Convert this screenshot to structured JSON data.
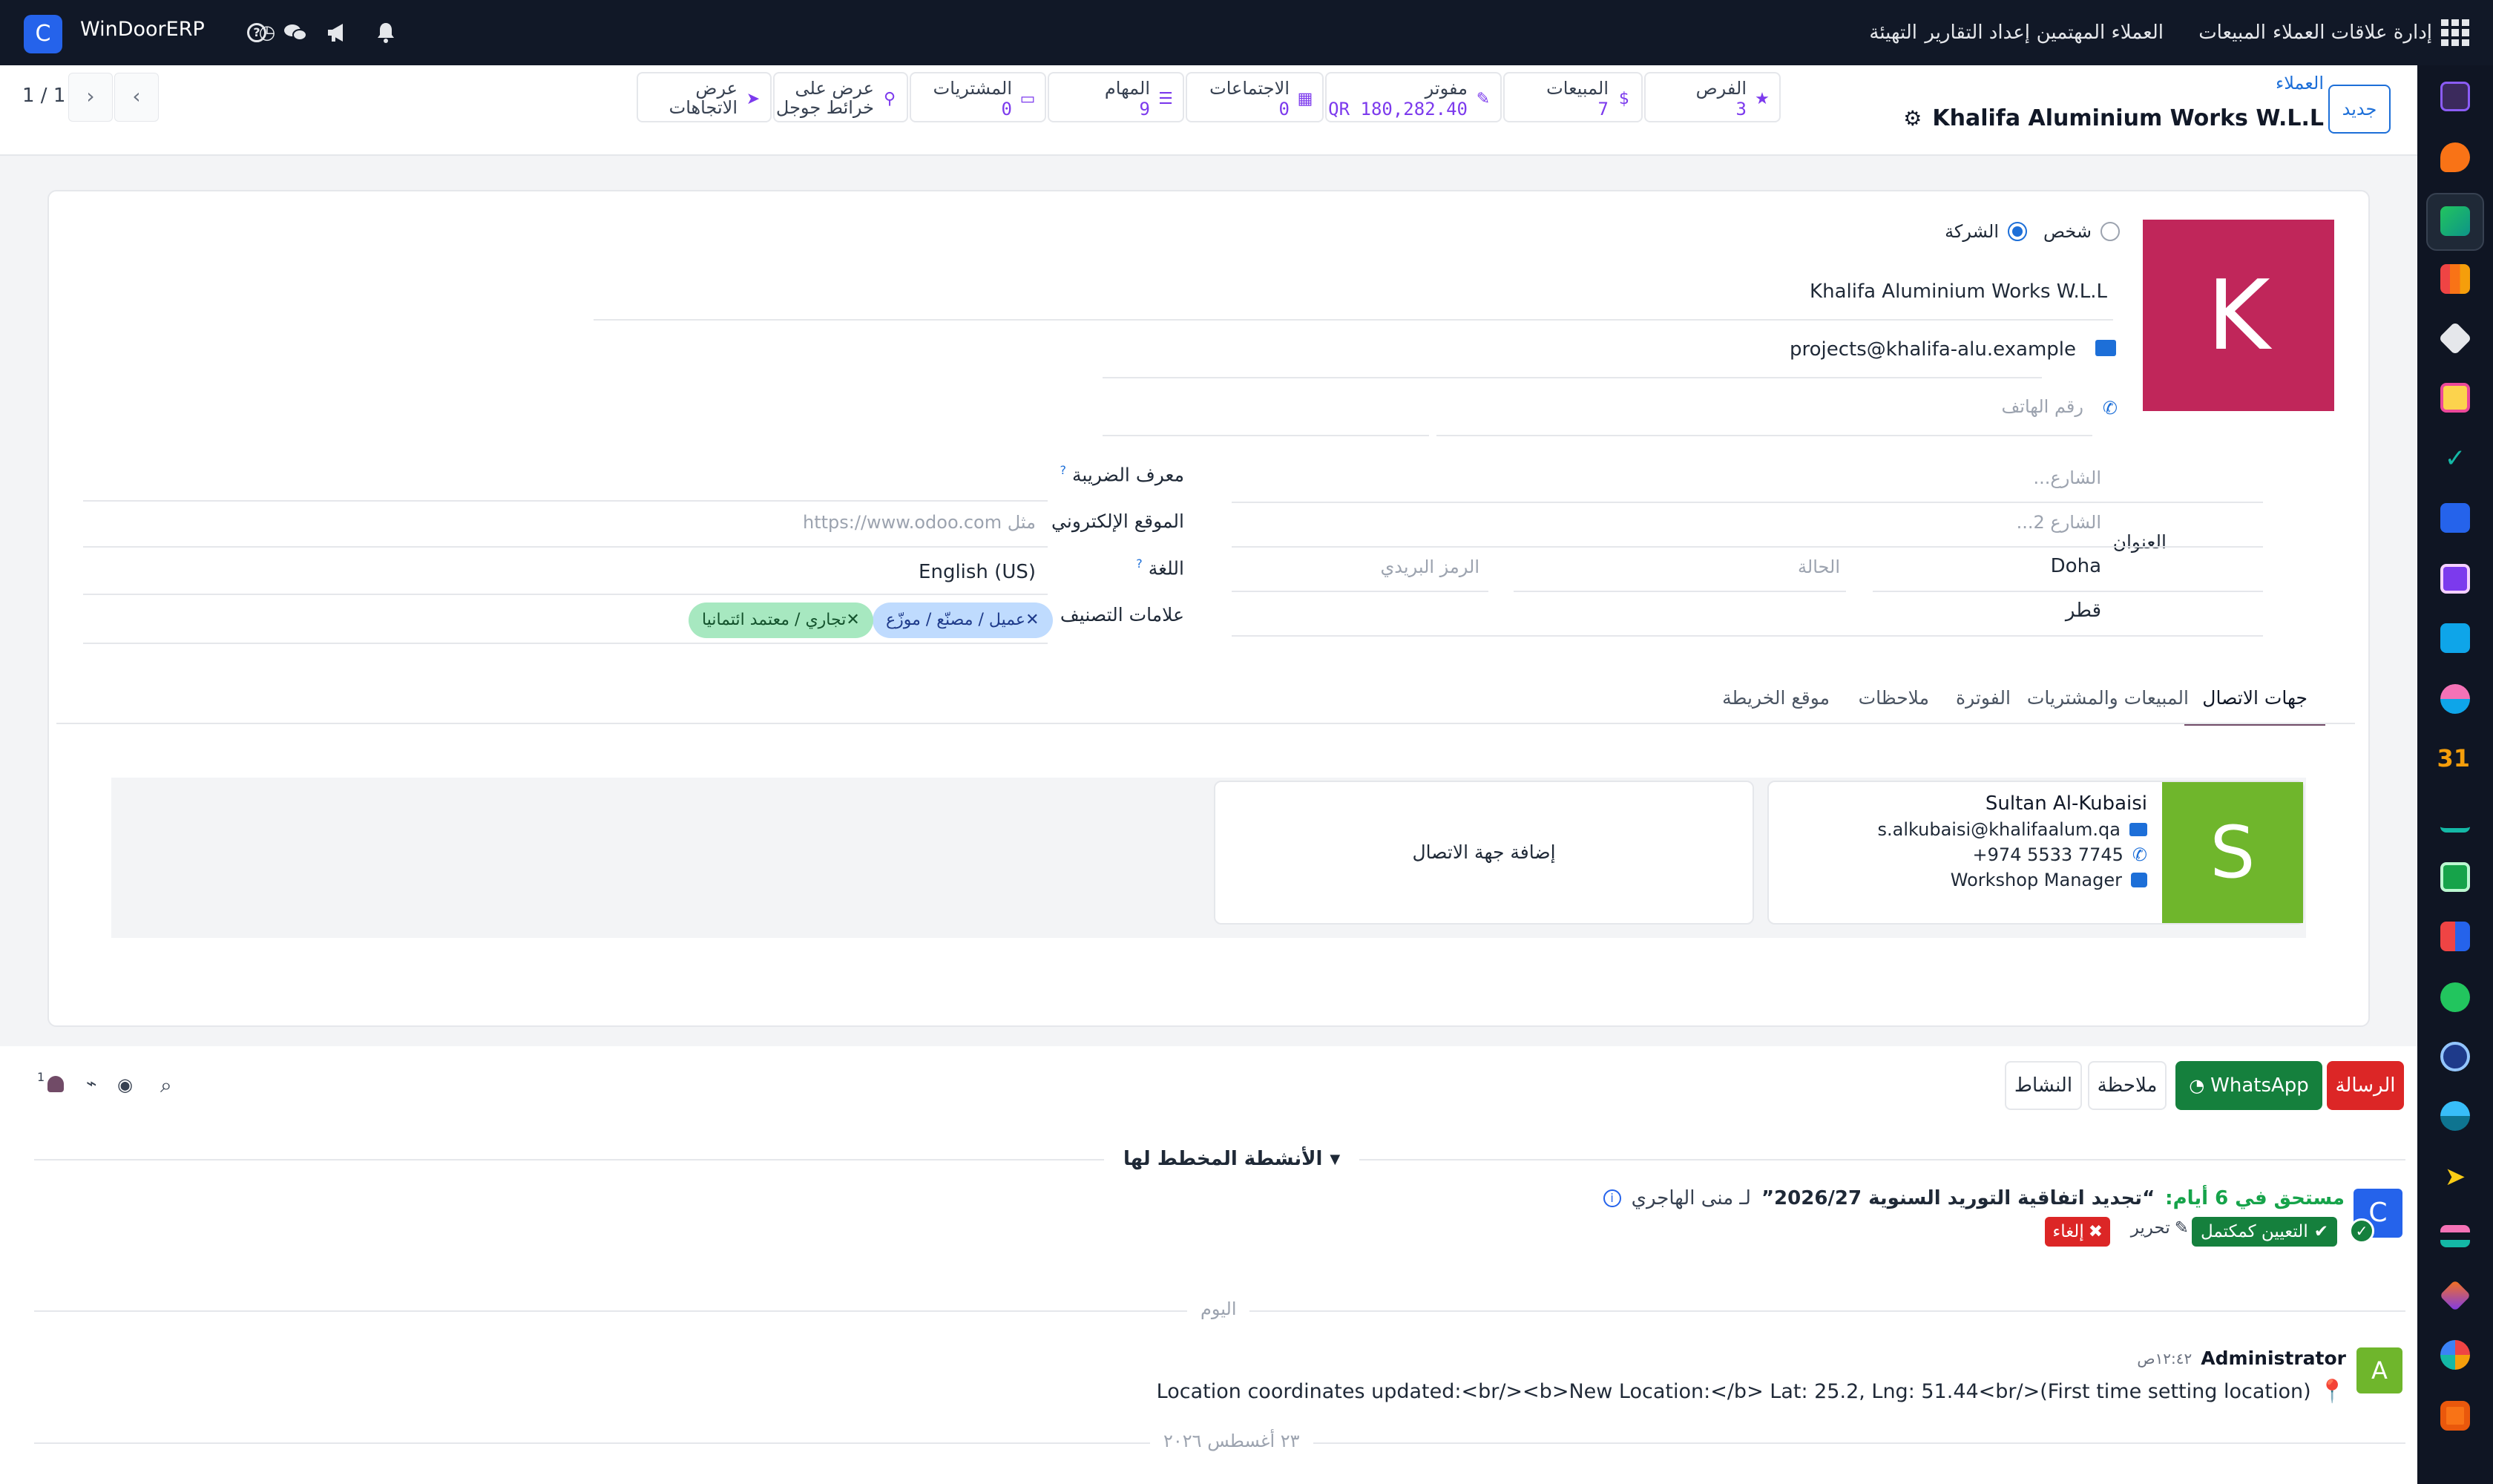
{
  "topbar": {
    "brand": "WinDoorERP",
    "menu": [
      "إدارة علاقات العملاء",
      "المبيعات",
      "العملاء المهتمين",
      "إعداد التقارير",
      "التهيئة"
    ]
  },
  "breadcrumb": {
    "parent": "العملاء",
    "current": "Khalifa Aluminium Works W.L.L"
  },
  "control": {
    "new_label": "جديد",
    "pager": "1 / 1"
  },
  "smart_buttons": [
    {
      "label": "الفرص",
      "value": "3",
      "icon": "star-icon"
    },
    {
      "label": "المبيعات",
      "value": "7",
      "icon": "dollar-icon"
    },
    {
      "label": "مفوتر",
      "value": "180,282.40 QR",
      "icon": "invoice-edit-icon"
    },
    {
      "label": "الاجتماعات",
      "value": "0",
      "icon": "calendar-icon"
    },
    {
      "label": "المهام",
      "value": "9",
      "icon": "tasks-icon"
    },
    {
      "label": "المشتريات",
      "value": "0",
      "icon": "credit-card-icon"
    },
    {
      "label": "عرض على",
      "label2": "خرائط جوجل",
      "icon": "map-marker-icon"
    },
    {
      "label": "عرض",
      "label2": "الاتجاهات",
      "icon": "direction-icon"
    }
  ],
  "form": {
    "avatar_letter": "K",
    "type_person": "شخص",
    "type_company": "الشركة",
    "name": "Khalifa Aluminium Works W.L.L",
    "email": "projects@khalifa-alu.example",
    "phone_placeholder": "رقم الهاتف",
    "address_label": "العنوان",
    "street_placeholder": "الشارع...",
    "street2_placeholder": "الشارع 2...",
    "city": "Doha",
    "state_placeholder": "الحالة",
    "zip_placeholder": "الرمز البريدي",
    "country": "قطر",
    "vat_label": "معرف الضريبة",
    "website_label": "الموقع الإلكتروني",
    "website_placeholder": "مثل https://www.odoo.com",
    "lang_label": "اللغة",
    "lang_value": "English (US)",
    "tags_label": "علامات التصنيف",
    "tags": [
      "عميل / مصنّع / موزّع",
      "تجاري / معتمد ائتمانيا"
    ],
    "tabs": [
      "جهات الاتصال",
      "المبيعات والمشتريات",
      "الفوترة",
      "ملاحظات",
      "موقع الخريطة"
    ]
  },
  "contact": {
    "avatar_letter": "S",
    "name": "Sultan Al-Kubaisi",
    "email": "s.alkubaisi@khalifaalum.qa",
    "phone": "+974 5533 7745",
    "role": "Workshop Manager",
    "add_label": "إضافة جهة الاتصال"
  },
  "chatter": {
    "message_btn": "الرسالة",
    "whatsapp_btn": "WhatsApp",
    "note_btn": "ملاحظة",
    "activity_btn": "النشاط",
    "followers_count": "1",
    "planned_label": "الأنشطة المخطط لها",
    "activity_due": "مستحق في 6 أيام:",
    "activity_title": "“تجديد اتفاقية التوريد السنوية 2026/27”",
    "activity_for": "لـ منى الهاجري",
    "mark_done": "التعيين كمكتمل",
    "edit": "تحرير",
    "cancel": "إلغاء",
    "today_sep": "اليوم",
    "msg_author": "Administrator",
    "msg_time": "١٢:٤٢ص",
    "msg_body": "Location coordinates updated:<br/><b>New Location:</b> Lat: 25.2, Lng: 51.44<br/>(First time setting location)",
    "date_sep": "٢٣ أغسطس ٢٠٢٦",
    "author_initial": "A"
  },
  "colors": {
    "topbar_bg": "#111827",
    "accent": "#714b67",
    "primary_blue": "#1d6fd8",
    "avatar_k": "#c0265a",
    "avatar_s": "#6fb62c",
    "whatsapp_green": "#15803d",
    "message_red": "#dc2626"
  }
}
